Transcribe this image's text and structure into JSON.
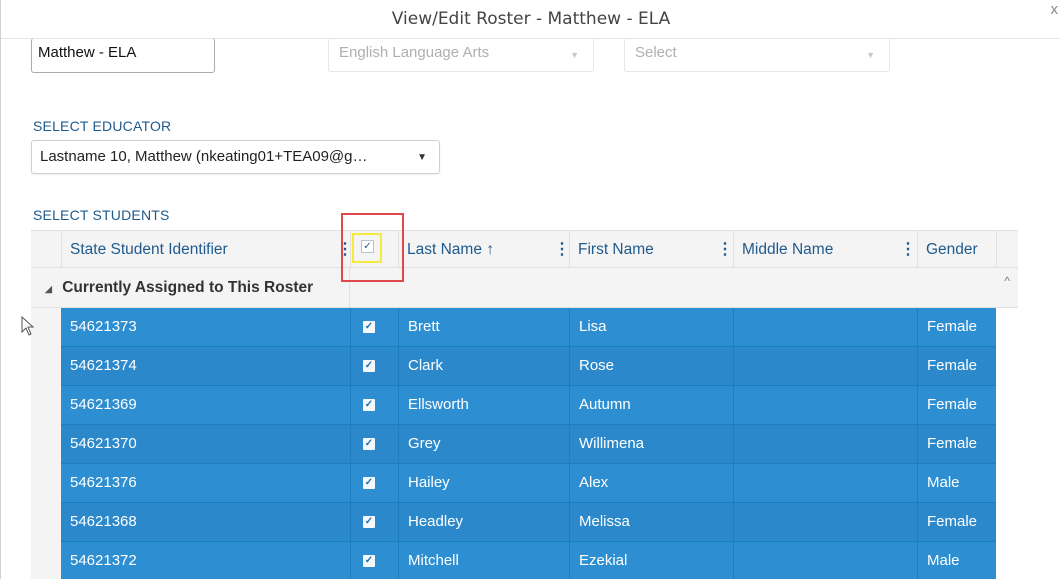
{
  "window": {
    "title": "View/Edit Roster - Matthew - ELA",
    "close_glyph": "x"
  },
  "roster_fields": {
    "name_value": "Matthew - ELA",
    "subject_value": "English Language Arts",
    "grade_placeholder": "Select"
  },
  "educator": {
    "label": "SELECT EDUCATOR",
    "selected": "Lastname 10, Matthew (nkeating01+TEA09@g…"
  },
  "students": {
    "label": "SELECT STUDENTS",
    "columns": [
      {
        "label": "State Student Identifier"
      },
      {
        "label": "✓"
      },
      {
        "label": "Last Name ↑"
      },
      {
        "label": "First Name"
      },
      {
        "label": "Middle Name"
      },
      {
        "label": "Gender"
      }
    ],
    "group_label": "Currently Assigned to This Roster",
    "rows": [
      {
        "id": "54621373",
        "checked": "✓",
        "last": "Brett",
        "first": "Lisa",
        "middle": "",
        "gender": "Female"
      },
      {
        "id": "54621374",
        "checked": "✓",
        "last": "Clark",
        "first": "Rose",
        "middle": "",
        "gender": "Female"
      },
      {
        "id": "54621369",
        "checked": "✓",
        "last": "Ellsworth",
        "first": "Autumn",
        "middle": "",
        "gender": "Female"
      },
      {
        "id": "54621370",
        "checked": "✓",
        "last": "Grey",
        "first": "Willimena",
        "middle": "",
        "gender": "Female"
      },
      {
        "id": "54621376",
        "checked": "✓",
        "last": "Hailey",
        "first": "Alex",
        "middle": "",
        "gender": "Male"
      },
      {
        "id": "54621368",
        "checked": "✓",
        "last": "Headley",
        "first": "Melissa",
        "middle": "",
        "gender": "Female"
      },
      {
        "id": "54621372",
        "checked": "✓",
        "last": "Mitchell",
        "first": "Ezekial",
        "middle": "",
        "gender": "Male"
      }
    ]
  },
  "colors": {
    "row_blue": "#2d8fd2",
    "header_text": "#1f5a8c",
    "highlight_red": "#e0494b",
    "highlight_yellow": "#f3ec3a"
  }
}
